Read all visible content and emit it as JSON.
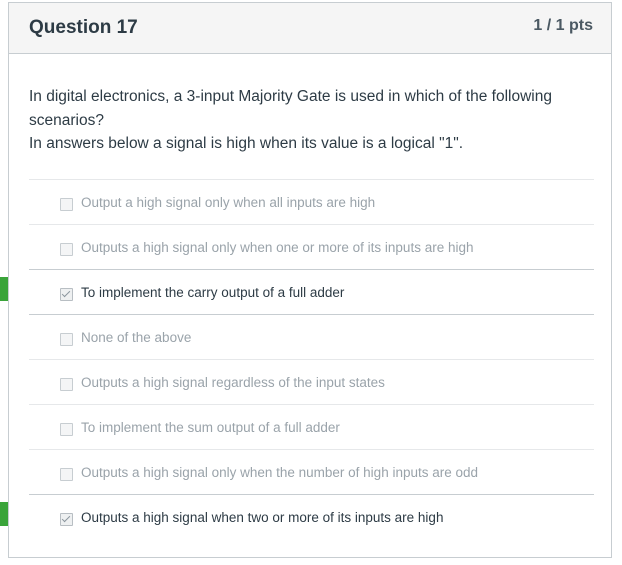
{
  "question": {
    "title": "Question 17",
    "points": "1 / 1 pts",
    "text_line1": "In digital electronics, a 3-input Majority Gate is used in which of the following scenarios?",
    "text_line2": "In answers below a signal is high when its value is a logical \"1\"."
  },
  "answers": [
    {
      "label": "Output a high signal only when all inputs are high",
      "checked": false,
      "correct": false
    },
    {
      "label": "Outputs a high signal only when one or more of its inputs are high",
      "checked": false,
      "correct": false
    },
    {
      "label": "To implement the carry output of a full adder",
      "checked": true,
      "correct": true
    },
    {
      "label": "None of the above",
      "checked": false,
      "correct": false
    },
    {
      "label": "Outputs a high signal regardless of the input states",
      "checked": false,
      "correct": false
    },
    {
      "label": "To implement the sum output of a full adder",
      "checked": false,
      "correct": false
    },
    {
      "label": "Outputs a high signal only when the number of high inputs are odd",
      "checked": false,
      "correct": false
    },
    {
      "label": "Outputs a high signal when two or more of its inputs are high",
      "checked": true,
      "correct": true
    }
  ],
  "colors": {
    "correct_flag": "#3aa43a",
    "header_bg": "#f5f5f5",
    "text": "#2d3b45",
    "muted_text": "#9aa3aa"
  }
}
